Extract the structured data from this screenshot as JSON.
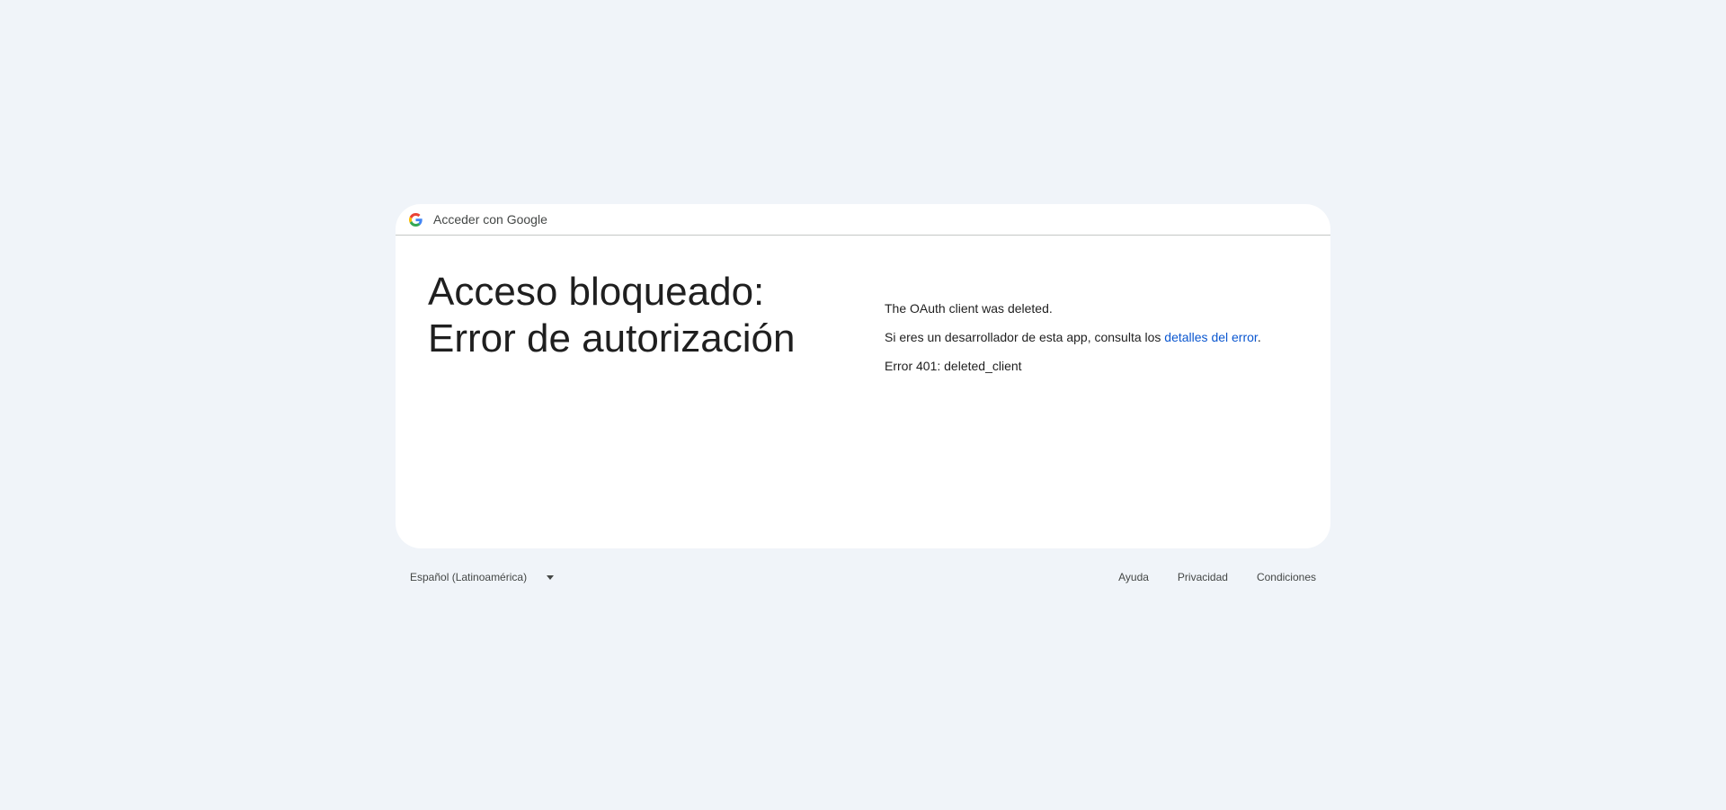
{
  "header": {
    "brand_icon": "google-g-icon",
    "title": "Acceder con Google"
  },
  "main": {
    "heading_line1": "Acceso bloqueado:",
    "heading_line2": "Error de autorización",
    "message": "The OAuth client was deleted.",
    "dev_text": "Si eres un desarrollador de esta app, consulta los ",
    "dev_link": "detalles del error",
    "dev_end": ".",
    "error_code": "Error 401: deleted_client"
  },
  "footer": {
    "language": "Español (Latinoamérica)",
    "links": [
      "Ayuda",
      "Privacidad",
      "Condiciones"
    ]
  },
  "colors": {
    "background": "#f0f4f9",
    "link": "#0b57d0",
    "text": "#1f1f1f"
  }
}
